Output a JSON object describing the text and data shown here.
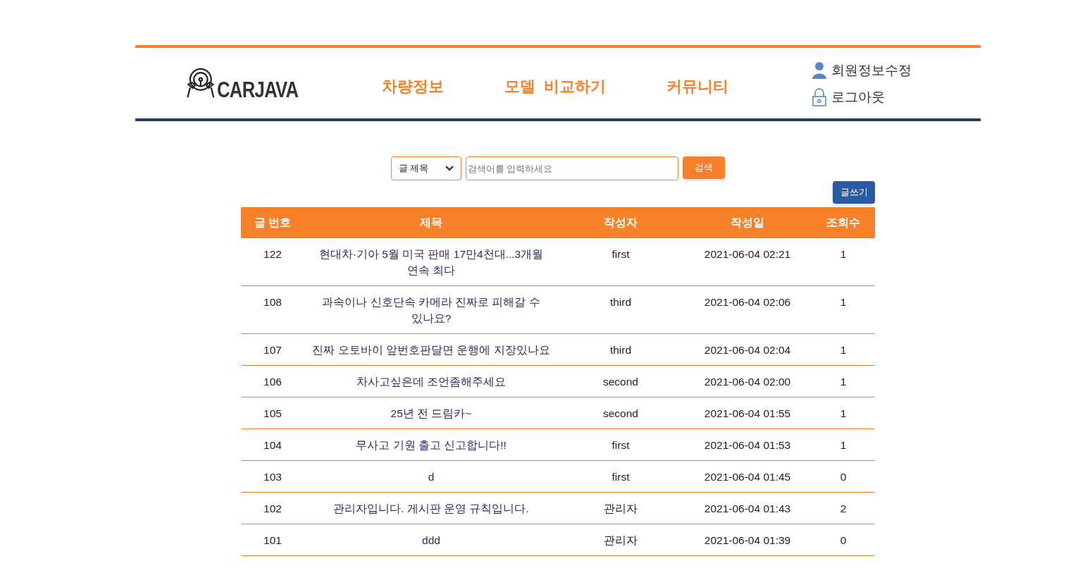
{
  "logo": {
    "text": "CARJAVA"
  },
  "nav": [
    "차량정보",
    "모델  비교하기",
    "커뮤니티"
  ],
  "user_menu": [
    {
      "kind": "user",
      "label": "회원정보수정"
    },
    {
      "kind": "lock",
      "label": "로그아웃"
    }
  ],
  "search": {
    "select": "글 제목",
    "placeholder": "검색어를 입력하세요",
    "button": "검색"
  },
  "write_button": "글쓰기",
  "table": {
    "columns": [
      "글 번호",
      "제목",
      "작성자",
      "작성일",
      "조회수"
    ],
    "rows": [
      [
        "122",
        "현대차·기아 5월 미국 판매 17만4천대...3개월 연속 최다",
        "first",
        "2021-06-04 02:21",
        "1"
      ],
      [
        "108",
        "과속이나 신호단속 카메라 진짜로 피해갈 수 있나요?",
        "third",
        "2021-06-04 02:06",
        "1"
      ],
      [
        "107",
        "진짜 오토바이 앞번호판달면 운행에 지장있나요",
        "third",
        "2021-06-04 02:04",
        "1"
      ],
      [
        "106",
        "차사고싶은데 조언좀해주세요",
        "second",
        "2021-06-04 02:00",
        "1"
      ],
      [
        "105",
        "25년 전 드림카~",
        "second",
        "2021-06-04 01:55",
        "1"
      ],
      [
        "104",
        "무사고 기원 출고 신고합니다!!",
        "first",
        "2021-06-04 01:53",
        "1"
      ],
      [
        "103",
        "d",
        "first",
        "2021-06-04 01:45",
        "0"
      ],
      [
        "102",
        "관리자입니다. 게시판 운영 규칙입니다.",
        "관리자",
        "2021-06-04 01:43",
        "2"
      ],
      [
        "101",
        "ddd",
        "관리자",
        "2021-06-04 01:39",
        "0"
      ]
    ]
  }
}
